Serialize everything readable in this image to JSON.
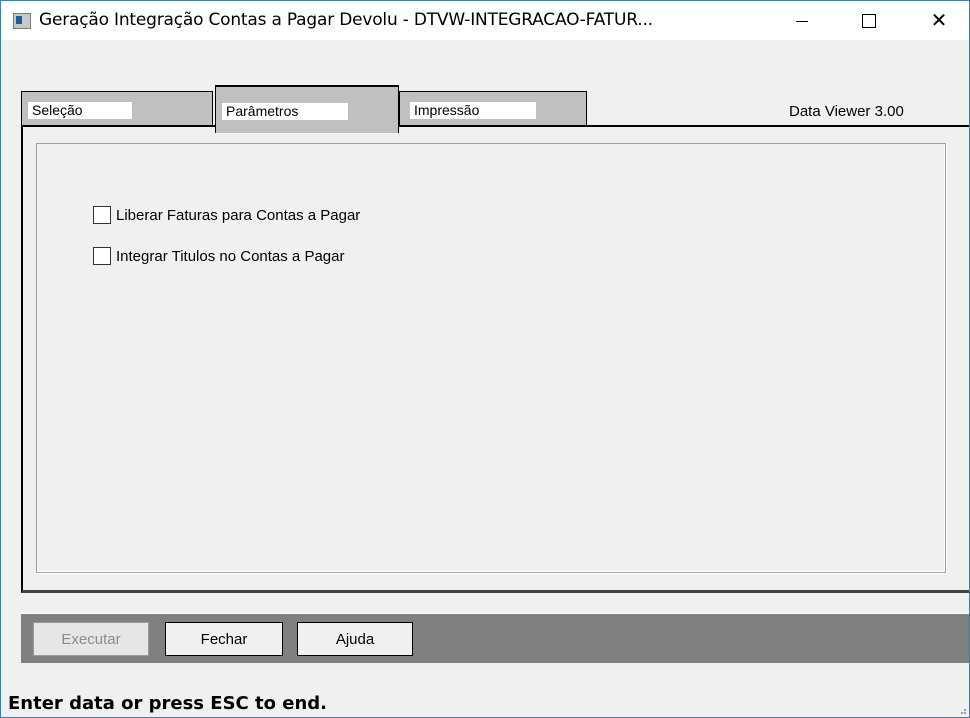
{
  "window": {
    "title": "Geração Integração Contas a Pagar Devolu - DTVW-INTEGRACAO-FATUR...",
    "controls": {
      "minimize": "–",
      "close": "✕"
    }
  },
  "tabs": [
    {
      "label": "Seleção",
      "active": false
    },
    {
      "label": "Parâmetros",
      "active": true
    },
    {
      "label": "Impressão",
      "active": false
    }
  ],
  "version_label": "Data Viewer 3.00",
  "parameters": {
    "checkboxes": [
      {
        "label": "Liberar Faturas para Contas a Pagar",
        "checked": false
      },
      {
        "label": "Integrar Titulos no Contas a Pagar",
        "checked": false
      }
    ]
  },
  "buttons": {
    "executar": "Executar",
    "fechar": "Fechar",
    "ajuda": "Ajuda"
  },
  "status": "Enter data or press ESC to end.",
  "colors": {
    "button_bar": "#808080",
    "tab": "#c0c0c0",
    "window_border": "#3c7fb1"
  }
}
